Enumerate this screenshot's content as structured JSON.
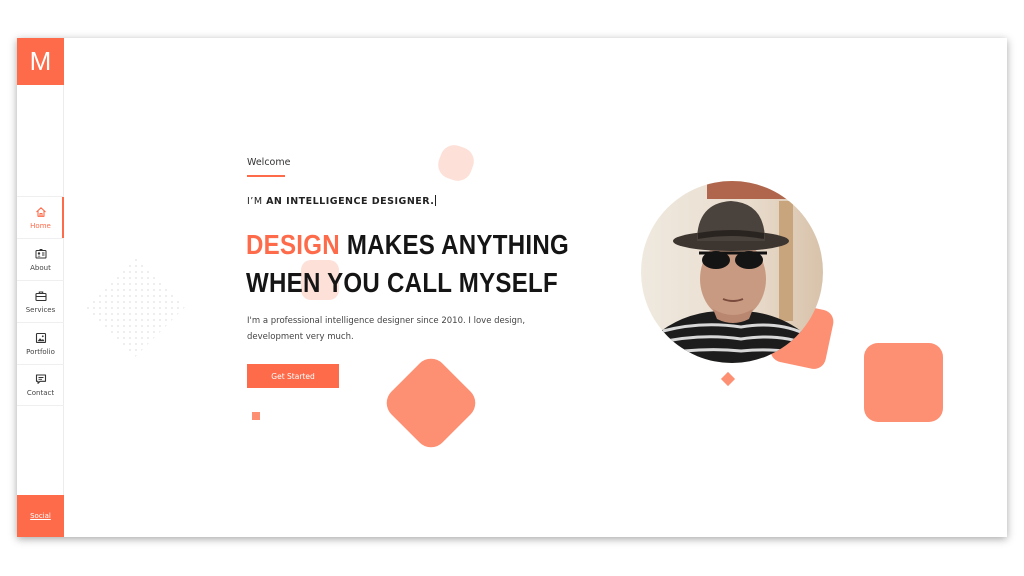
{
  "sidebar": {
    "logo": "M",
    "items": [
      {
        "label": "Home",
        "icon": "home-icon",
        "active": true
      },
      {
        "label": "About",
        "icon": "id-card-icon",
        "active": false
      },
      {
        "label": "Services",
        "icon": "briefcase-icon",
        "active": false
      },
      {
        "label": "Portfolio",
        "icon": "image-icon",
        "active": false
      },
      {
        "label": "Contact",
        "icon": "chat-icon",
        "active": false
      }
    ],
    "social_label": "Social"
  },
  "hero": {
    "welcome": "Welcome",
    "intro_prefix": "I’M",
    "intro_role": "AN INTELLIGENCE DESIGNER.",
    "headline_accent": "DESIGN",
    "headline_rest": "MAKES ANYTHING",
    "headline_line2": "WHEN YOU CALL MYSELF",
    "description": "I'm a professional intelligence designer since 2010. I love design, development very much.",
    "cta_label": "Get Started"
  },
  "colors": {
    "accent": "#fd6b4a",
    "shape": "#fd8f73",
    "shape_light": "#fde1d9",
    "text": "#151515"
  }
}
